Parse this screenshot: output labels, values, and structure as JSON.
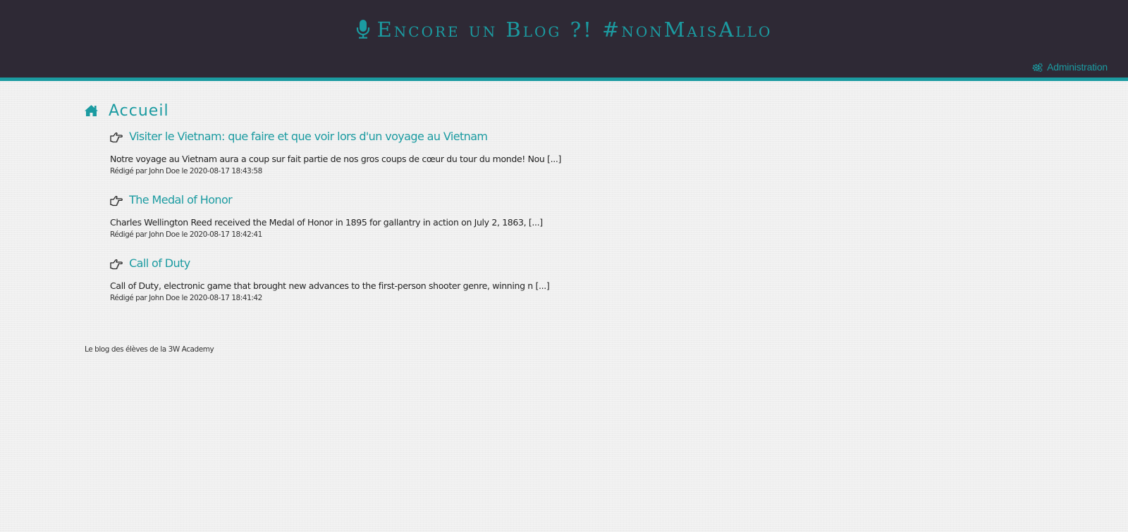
{
  "header": {
    "site_title": "Encore un Blog ?! #nonMaisAllo",
    "site_icon": "microphone-icon",
    "admin_label": "Administration",
    "admin_icon": "gears-icon"
  },
  "main": {
    "page_title": "Accueil",
    "page_icon": "home-icon",
    "posts": [
      {
        "title": "Visiter le Vietnam: que faire et que voir lors d'un voyage au Vietnam",
        "excerpt": "Notre voyage au Vietnam aura a coup sur fait partie de nos gros coups de cœur du tour du monde! Nou [...]",
        "meta": "Rédigé par John Doe le 2020-08-17 18:43:58",
        "icon": "hand-pointing-right-icon"
      },
      {
        "title": "The Medal of Honor",
        "excerpt": "Charles Wellington Reed received the Medal of Honor in 1895 for gallantry in action on July 2, 1863, [...]",
        "meta": "Rédigé par John Doe le 2020-08-17 18:42:41",
        "icon": "hand-pointing-right-icon"
      },
      {
        "title": "Call of Duty",
        "excerpt": "Call of Duty, electronic game that brought new advances to the first-person shooter genre, winning n [...]",
        "meta": "Rédigé par John Doe le 2020-08-17 18:41:42",
        "icon": "hand-pointing-right-icon"
      }
    ]
  },
  "footer": {
    "text": "Le blog des élèves de la 3W Academy"
  },
  "colors": {
    "accent": "#1b9ba1",
    "header_bg": "#2e2935",
    "page_bg": "#efefef",
    "text": "#222222"
  }
}
